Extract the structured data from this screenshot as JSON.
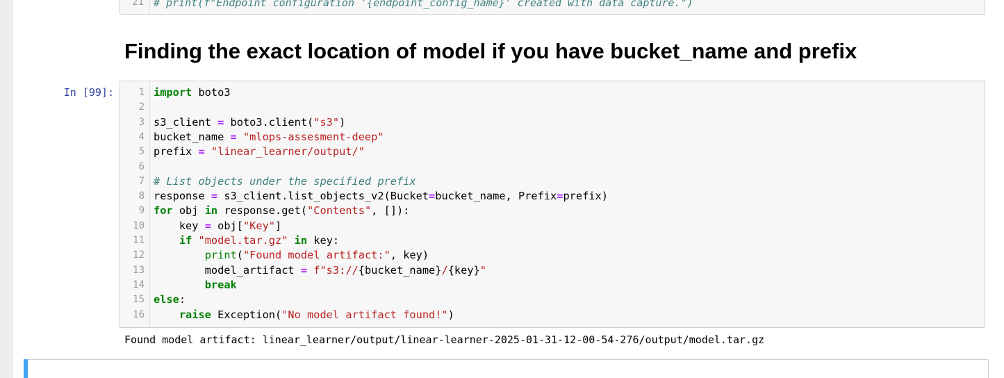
{
  "prev_cell": {
    "line_number": "21",
    "code": "# print(f\"Endpoint configuration '{endpoint_config_name}' created with data capture.\")"
  },
  "heading": "Finding the exact location of model if you have bucket_name and prefix",
  "cell": {
    "prompt": "In [99]:",
    "line_numbers": [
      "1",
      "2",
      "3",
      "4",
      "5",
      "6",
      "7",
      "8",
      "9",
      "10",
      "11",
      "12",
      "13",
      "14",
      "15",
      "16"
    ],
    "lines": [
      [
        {
          "t": "import",
          "c": "kw"
        },
        {
          "t": " boto3",
          "c": ""
        }
      ],
      [],
      [
        {
          "t": "s3_client ",
          "c": ""
        },
        {
          "t": "=",
          "c": "op"
        },
        {
          "t": " boto3.client(",
          "c": ""
        },
        {
          "t": "\"s3\"",
          "c": "str"
        },
        {
          "t": ")",
          "c": ""
        }
      ],
      [
        {
          "t": "bucket_name ",
          "c": ""
        },
        {
          "t": "=",
          "c": "op"
        },
        {
          "t": " ",
          "c": ""
        },
        {
          "t": "\"mlops-assesment-deep\"",
          "c": "str"
        }
      ],
      [
        {
          "t": "prefix ",
          "c": ""
        },
        {
          "t": "=",
          "c": "op"
        },
        {
          "t": " ",
          "c": ""
        },
        {
          "t": "\"linear_learner/output/\"",
          "c": "str"
        }
      ],
      [],
      [
        {
          "t": "# List objects under the specified prefix",
          "c": "cm"
        }
      ],
      [
        {
          "t": "response ",
          "c": ""
        },
        {
          "t": "=",
          "c": "op"
        },
        {
          "t": " s3_client.list_objects_v2(Bucket",
          "c": ""
        },
        {
          "t": "=",
          "c": "op"
        },
        {
          "t": "bucket_name, Prefix",
          "c": ""
        },
        {
          "t": "=",
          "c": "op"
        },
        {
          "t": "prefix)",
          "c": ""
        }
      ],
      [
        {
          "t": "for",
          "c": "kw"
        },
        {
          "t": " obj ",
          "c": ""
        },
        {
          "t": "in",
          "c": "kw"
        },
        {
          "t": " response.get(",
          "c": ""
        },
        {
          "t": "\"Contents\"",
          "c": "str"
        },
        {
          "t": ", []):",
          "c": ""
        }
      ],
      [
        {
          "t": "    key ",
          "c": ""
        },
        {
          "t": "=",
          "c": "op"
        },
        {
          "t": " obj[",
          "c": ""
        },
        {
          "t": "\"Key\"",
          "c": "str"
        },
        {
          "t": "]",
          "c": ""
        }
      ],
      [
        {
          "t": "    ",
          "c": ""
        },
        {
          "t": "if",
          "c": "kw"
        },
        {
          "t": " ",
          "c": ""
        },
        {
          "t": "\"model.tar.gz\"",
          "c": "str"
        },
        {
          "t": " ",
          "c": ""
        },
        {
          "t": "in",
          "c": "kw"
        },
        {
          "t": " key:",
          "c": ""
        }
      ],
      [
        {
          "t": "        ",
          "c": ""
        },
        {
          "t": "print",
          "c": "bi"
        },
        {
          "t": "(",
          "c": ""
        },
        {
          "t": "\"Found model artifact:\"",
          "c": "str"
        },
        {
          "t": ", key)",
          "c": ""
        }
      ],
      [
        {
          "t": "        model_artifact ",
          "c": ""
        },
        {
          "t": "=",
          "c": "op"
        },
        {
          "t": " ",
          "c": ""
        },
        {
          "t": "f\"s3://",
          "c": "str"
        },
        {
          "t": "{bucket_name}",
          "c": ""
        },
        {
          "t": "/",
          "c": "str"
        },
        {
          "t": "{key}",
          "c": ""
        },
        {
          "t": "\"",
          "c": "str"
        }
      ],
      [
        {
          "t": "        ",
          "c": ""
        },
        {
          "t": "break",
          "c": "kw"
        }
      ],
      [
        {
          "t": "else",
          "c": "kw"
        },
        {
          "t": ":",
          "c": ""
        }
      ],
      [
        {
          "t": "    ",
          "c": ""
        },
        {
          "t": "raise",
          "c": "kw"
        },
        {
          "t": " Exception(",
          "c": ""
        },
        {
          "t": "\"No model artifact found!\"",
          "c": "str"
        },
        {
          "t": ")",
          "c": ""
        }
      ]
    ]
  },
  "output": "Found model artifact: linear_learner/output/linear-learner-2025-01-31-12-00-54-276/output/model.tar.gz",
  "colors": {
    "keyword": "#008000",
    "operator": "#aa22ff",
    "string": "#ba2121",
    "comment": "#408080",
    "prompt": "#303f9f",
    "selected_cell_bar": "#42a5f5"
  }
}
